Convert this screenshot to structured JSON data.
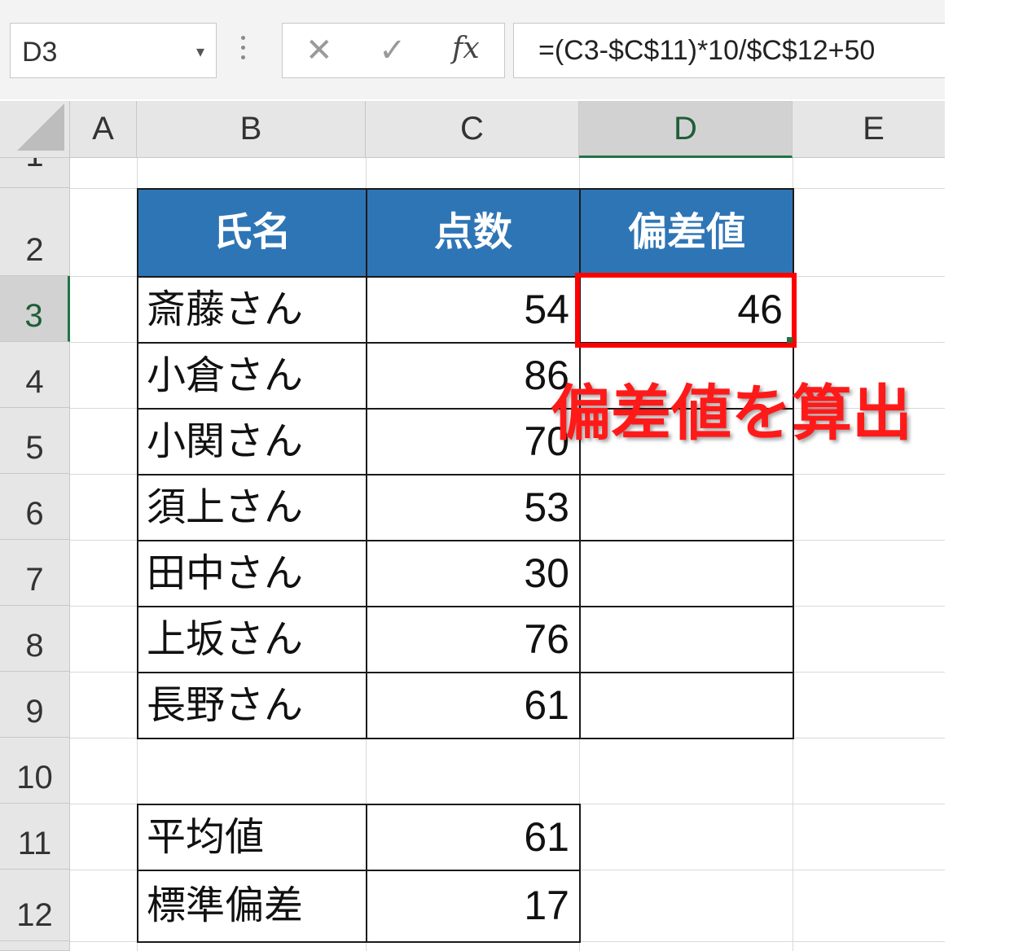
{
  "formula_bar": {
    "cell_ref": "D3",
    "dropdown_icon": "chevron-down-icon",
    "cancel_glyph": "✕",
    "enter_glyph": "✓",
    "fx_glyph": "fx",
    "formula": "=(C3-$C$11)*10/$C$12+50"
  },
  "columns": [
    "A",
    "B",
    "C",
    "D",
    "E"
  ],
  "selected_column": "D",
  "rows": [
    "1",
    "2",
    "3",
    "4",
    "5",
    "6",
    "7",
    "8",
    "9",
    "10",
    "11",
    "12"
  ],
  "selected_row": "3",
  "table": {
    "headers": {
      "name": "氏名",
      "score": "点数",
      "deviation": "偏差値"
    },
    "records": [
      {
        "name": "斎藤さん",
        "score": "54",
        "deviation": "46"
      },
      {
        "name": "小倉さん",
        "score": "86",
        "deviation": ""
      },
      {
        "name": "小関さん",
        "score": "70",
        "deviation": ""
      },
      {
        "name": "須上さん",
        "score": "53",
        "deviation": ""
      },
      {
        "name": "田中さん",
        "score": "30",
        "deviation": ""
      },
      {
        "name": "上坂さん",
        "score": "76",
        "deviation": ""
      },
      {
        "name": "長野さん",
        "score": "61",
        "deviation": ""
      }
    ]
  },
  "stats": {
    "mean_label": "平均値",
    "mean_value": "61",
    "stdev_label": "標準偏差",
    "stdev_value": "17"
  },
  "annotation": "偏差値を算出",
  "colors": {
    "header_fill": "#2e75b6",
    "highlight": "#ff0000",
    "excel_green": "#217346"
  }
}
